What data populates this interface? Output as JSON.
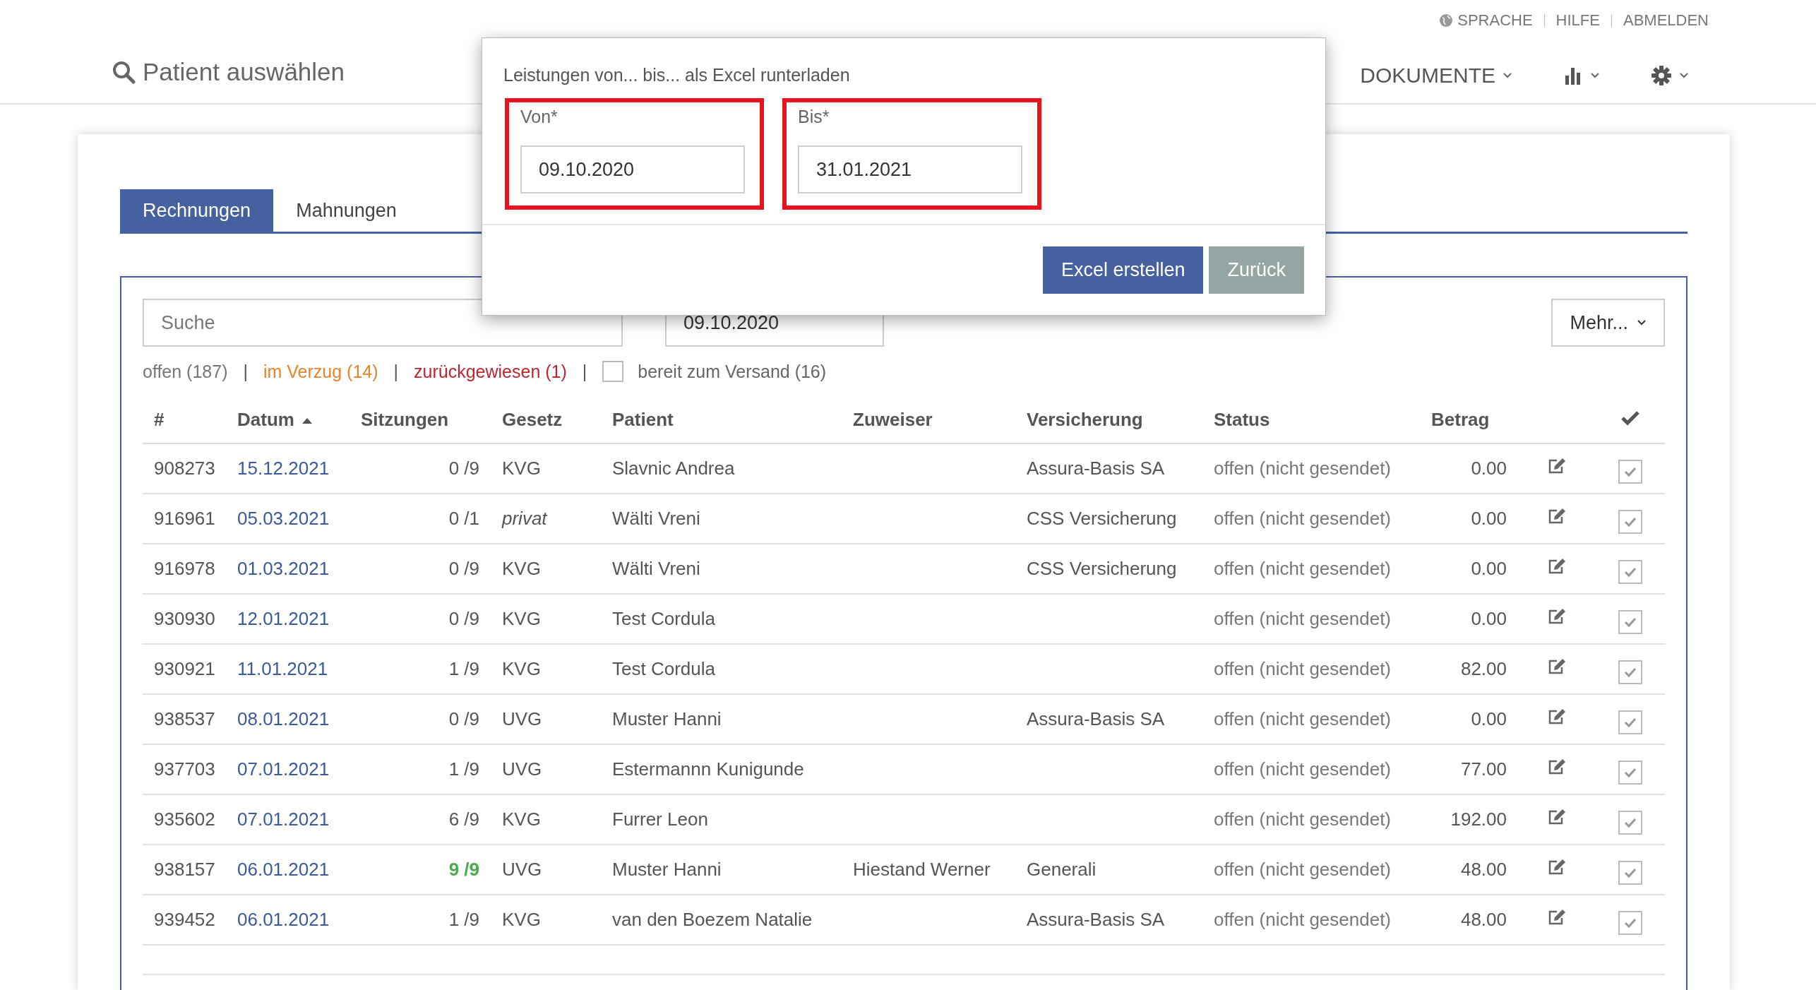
{
  "top_links": [
    {
      "label": "SPRACHE"
    },
    {
      "label": "HILFE"
    },
    {
      "label": "ABMELDEN"
    }
  ],
  "patient_search": {
    "label": "Patient auswählen"
  },
  "nav": [
    {
      "kind": "text",
      "label": "DOKUMENTE"
    },
    {
      "kind": "chart"
    },
    {
      "kind": "gear"
    }
  ],
  "tabs": [
    {
      "label": "Rechnungen",
      "selected": true
    },
    {
      "label": "Mahnungen",
      "selected": false
    }
  ],
  "search": {
    "placeholder": "Suche"
  },
  "date_filter": {
    "value": "09.10.2020"
  },
  "more_button": {
    "label": "Mehr..."
  },
  "filters": [
    {
      "label": "offen (187)",
      "color": "#777777",
      "separator": "|"
    },
    {
      "label": "im Verzug (14)",
      "color": "#e8832a",
      "separator": "|"
    },
    {
      "label": "zurückgewiesen (1)",
      "color": "#c0262d",
      "separator": "|"
    }
  ],
  "ready_filter": {
    "label": "bereit zum Versand (16)",
    "checked": false
  },
  "table": {
    "columns": [
      {
        "label": "#",
        "sorted_ascending": false
      },
      {
        "label": "Datum",
        "sorted_ascending": true
      },
      {
        "label": "Sitzungen",
        "sorted_ascending": false
      },
      {
        "label": "Gesetz",
        "sorted_ascending": false
      },
      {
        "label": "Patient",
        "sorted_ascending": false
      },
      {
        "label": "Zuweiser",
        "sorted_ascending": false
      },
      {
        "label": "Versicherung",
        "sorted_ascending": false
      },
      {
        "label": "Status",
        "sorted_ascending": false
      },
      {
        "label": "Betrag",
        "sorted_ascending": false
      }
    ],
    "rows": [
      {
        "number": "908273",
        "date": "15.12.2021",
        "sessions": "0 /9",
        "sessions_complete": false,
        "law": "KVG",
        "law_private": false,
        "patient": "Slavnic Andrea",
        "insurance": "Assura-Basis SA",
        "status": "offen (nicht gesendet)",
        "amount": "0.00",
        "checked": true
      },
      {
        "number": "916961",
        "date": "05.03.2021",
        "sessions": "0 /1",
        "sessions_complete": false,
        "law": "privat",
        "law_private": true,
        "patient": "Wälti Vreni",
        "insurance": "CSS Versicherung",
        "status": "offen (nicht gesendet)",
        "amount": "0.00",
        "checked": true
      },
      {
        "number": "916978",
        "date": "01.03.2021",
        "sessions": "0 /9",
        "sessions_complete": false,
        "law": "KVG",
        "law_private": false,
        "patient": "Wälti Vreni",
        "insurance": "CSS Versicherung",
        "status": "offen (nicht gesendet)",
        "amount": "0.00",
        "checked": true
      },
      {
        "number": "930930",
        "date": "12.01.2021",
        "sessions": "0 /9",
        "sessions_complete": false,
        "law": "KVG",
        "law_private": false,
        "patient": "Test Cordula",
        "status": "offen (nicht gesendet)",
        "amount": "0.00",
        "checked": true
      },
      {
        "number": "930921",
        "date": "11.01.2021",
        "sessions": "1 /9",
        "sessions_complete": false,
        "law": "KVG",
        "law_private": false,
        "patient": "Test Cordula",
        "status": "offen (nicht gesendet)",
        "amount": "82.00",
        "checked": true
      },
      {
        "number": "938537",
        "date": "08.01.2021",
        "sessions": "0 /9",
        "sessions_complete": false,
        "law": "UVG",
        "law_private": false,
        "patient": "Muster Hanni",
        "insurance": "Assura-Basis SA",
        "status": "offen (nicht gesendet)",
        "amount": "0.00",
        "checked": true
      },
      {
        "number": "937703",
        "date": "07.01.2021",
        "sessions": "1 /9",
        "sessions_complete": false,
        "law": "UVG",
        "law_private": false,
        "patient": "Estermannn Kunigunde",
        "status": "offen (nicht gesendet)",
        "amount": "77.00",
        "checked": true
      },
      {
        "number": "935602",
        "date": "07.01.2021",
        "sessions": "6 /9",
        "sessions_complete": false,
        "law": "KVG",
        "law_private": false,
        "patient": "Furrer Leon",
        "status": "offen (nicht gesendet)",
        "amount": "192.00",
        "checked": true
      },
      {
        "number": "938157",
        "date": "06.01.2021",
        "sessions": "9 /9",
        "sessions_complete": true,
        "law": "UVG",
        "law_private": false,
        "patient": "Muster Hanni",
        "referrer": "Hiestand Werner",
        "insurance": "Generali",
        "status": "offen (nicht gesendet)",
        "amount": "48.00",
        "checked": true
      },
      {
        "number": "939452",
        "date": "06.01.2021",
        "sessions": "1 /9",
        "sessions_complete": false,
        "law": "KVG",
        "law_private": false,
        "patient": "van den Boezem Natalie",
        "insurance": "Assura-Basis SA",
        "status": "offen (nicht gesendet)",
        "amount": "48.00",
        "checked": true
      }
    ]
  },
  "dialog": {
    "title": "Leistungen von... bis... als Excel runterladen",
    "fields": [
      {
        "label": "Von*",
        "value": "09.10.2020",
        "highlighted": true
      },
      {
        "label": "Bis*",
        "value": "31.01.2021",
        "highlighted": true
      }
    ],
    "buttons": [
      {
        "label": "Excel erstellen",
        "kind": "primary"
      },
      {
        "label": "Zurück",
        "kind": "secondary"
      }
    ]
  }
}
